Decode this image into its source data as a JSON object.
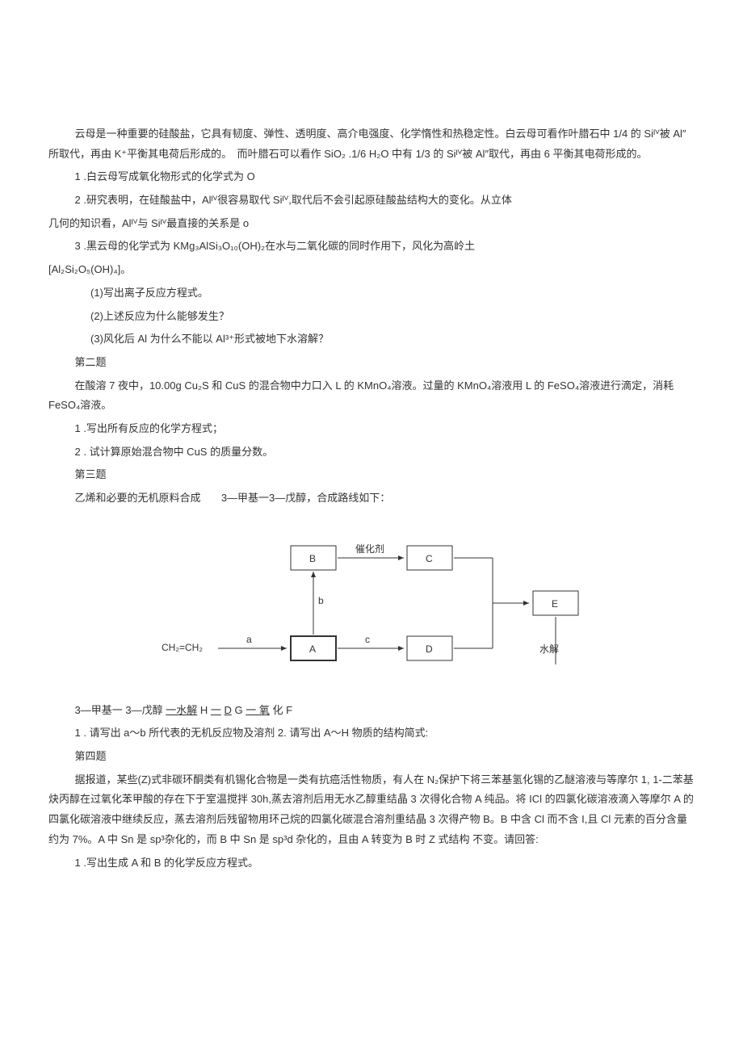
{
  "p1": "云母是一种重要的硅酸盐，它具有韧度、弹性、透明度、高介电强度、化学惰性和热稳定性。白云母可看作叶腊石中 1/4 的 Siᴵⱽ被 Al″所取代，再由 K⁺平衡其电荷后形成的。　而叶腊石可以看作 SiO₂ .1/6 H₂O 中有 1/3 的 Siᴵⱽ被 Al″取代，再由 6 平衡其电荷形成的。",
  "p2": "1 .白云母写成氧化物形式的化学式为 O",
  "p3": "2 .研究表明，在硅酸盐中，Alᴵⱽ很容易取代 Siᴵⱽ,取代后不会引起原硅酸盐结构大的变化。从立体",
  "p4": "几何的知识看，Alᴵⱽ与 Siᴵⱽ最直接的关系是 o",
  "p5": "3 .黑云母的化学式为 KMg₃AlSi₃O₁₀(OH)₂在水与二氧化碳的同时作用下，风化为高岭土",
  "p6": " [Al₂Si₂O₅(OH)₄]。",
  "p7": "(1)写出离子反应方程式。",
  "p8": "(2)上述反应为什么能够发生？",
  "p9": "(3)风化后 Al 为什么不能以 Al³⁺形式被地下水溶解？",
  "q2_head": "第二题",
  "q2_p1": "在酸溶 7 夜中，10.00g Cu₂S 和 CuS 的混合物中力口入 L 的 KMnO₄溶液。过量的 KMnO₄溶液用 L 的 FeSO₄溶液进行滴定，消耗 FeSO₄溶液。",
  "q2_p2": "1 .写出所有反应的化学方程式；",
  "q2_p3": "2 . 试计算原始混合物中 CuS 的质量分数。",
  "q3_head": "第三题",
  "q3_p1_a": "乙烯和必要的无机原料合成",
  "q3_p1_b": "3—甲基一3—戊醇，合成路线如下：",
  "diagram": {
    "left": "CH₂=CH₂",
    "A": "A",
    "B": "B",
    "C": "C",
    "D": "D",
    "E": "E",
    "a": "a",
    "b": "b",
    "c": "c",
    "cat": "催化剂",
    "hydro": "水解"
  },
  "q3_p2_a": "3—甲基一 3—戊醇",
  "q3_p2_b": "一水解",
  "q3_p2_c": "H",
  "q3_p2_d": "一",
  "q3_p2_e": "D",
  "q3_p2_f": "G",
  "q3_p2_g": "一 氧",
  "q3_p2_h": "化",
  "q3_p2_i": "F",
  "q3_p3": "1 . 请写出 a〜b 所代表的无机反应物及溶剂 2. 请写出 A〜H 物质的结构简式:",
  "q4_head": "第四题",
  "q4_p1": "据报道，某些(Z)式非碳环酮类有机锡化合物是一类有抗癌活性物质，有人在 N₂保护下将三苯基氢化锡的乙醚溶液与等摩尔 1, 1-二苯基炔丙醇在过氧化苯甲酸的存在下于室温搅拌 30h,蒸去溶剂后用无水乙醇重结晶 3 次得化合物 A 纯品。将 ICl 的四氯化碳溶液滴入等摩尔 A 的四氯化碳溶液中继续反应，蒸去溶剂后残留物用环己烷的四氯化碳混合溶剂重结晶 3 次得产物 B。B 中含 Cl 而不含 I,且 Cl 元素的百分含量约为 7%。A 中 Sn 是 sp³杂化的，而 B 中 Sn 是 sp³d 杂化的，且由 A 转变为 B 时 Z 式结构 不变。请回答:",
  "q4_p2": "1 .写出生成 A 和 B 的化学反应方程式。"
}
